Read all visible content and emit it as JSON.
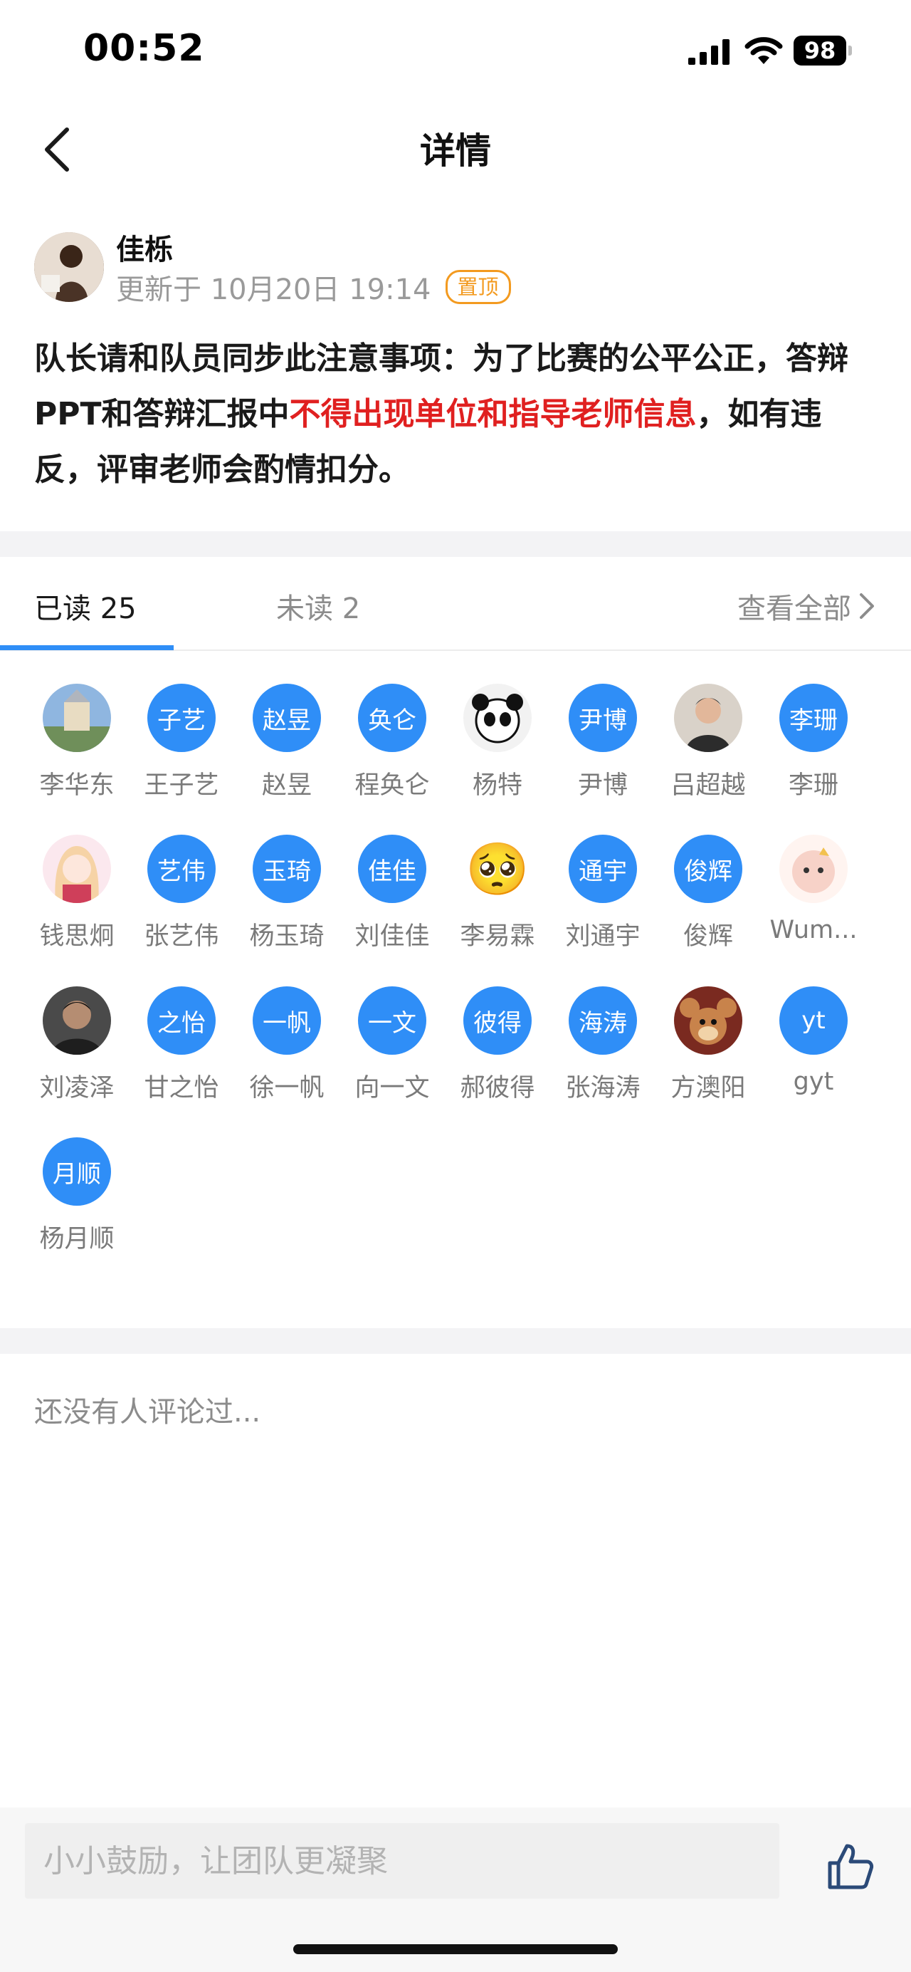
{
  "status_bar": {
    "time": "00:52",
    "battery": "98"
  },
  "nav": {
    "title": "详情"
  },
  "post": {
    "author": "佳栎",
    "updated": "更新于 10月20日 19:14",
    "pin_badge": "置顶",
    "body_part1": "队长请和队员同步此注意事项：为了比赛的公平公正，答辩PPT和答辩汇报中",
    "body_highlight": "不得出现单位和指导老师信息",
    "body_part2": "，如有违反，评审老师会酌情扣分。"
  },
  "tabs": {
    "read": "已读 25",
    "unread": "未读 2",
    "view_all": "查看全部"
  },
  "members": [
    {
      "name": "李华东",
      "avatar_text": "",
      "avatar_kind": "photo-castle"
    },
    {
      "name": "王子艺",
      "avatar_text": "子艺"
    },
    {
      "name": "赵昱",
      "avatar_text": "赵昱"
    },
    {
      "name": "程奂仑",
      "avatar_text": "奂仑"
    },
    {
      "name": "杨特",
      "avatar_text": "",
      "avatar_kind": "photo-panda"
    },
    {
      "name": "尹博",
      "avatar_text": "尹博"
    },
    {
      "name": "吕超越",
      "avatar_text": "",
      "avatar_kind": "photo-man"
    },
    {
      "name": "李珊",
      "avatar_text": "李珊"
    },
    {
      "name": "钱思炯",
      "avatar_text": "",
      "avatar_kind": "photo-anime"
    },
    {
      "name": "张艺伟",
      "avatar_text": "艺伟"
    },
    {
      "name": "杨玉琦",
      "avatar_text": "玉琦"
    },
    {
      "name": "刘佳佳",
      "avatar_text": "佳佳"
    },
    {
      "name": "李易霖",
      "avatar_text": "🥺",
      "avatar_kind": "emoji"
    },
    {
      "name": "刘通宇",
      "avatar_text": "通宇"
    },
    {
      "name": "俊辉",
      "avatar_text": "俊辉"
    },
    {
      "name": "Wum...",
      "avatar_text": "",
      "avatar_kind": "photo-cartoon"
    },
    {
      "name": "刘凌泽",
      "avatar_text": "",
      "avatar_kind": "photo-portrait"
    },
    {
      "name": "甘之怡",
      "avatar_text": "之怡"
    },
    {
      "name": "徐一帆",
      "avatar_text": "一帆"
    },
    {
      "name": "向一文",
      "avatar_text": "一文"
    },
    {
      "name": "郝彼得",
      "avatar_text": "彼得"
    },
    {
      "name": "张海涛",
      "avatar_text": "海涛"
    },
    {
      "name": "方澳阳",
      "avatar_text": "",
      "avatar_kind": "photo-jerry"
    },
    {
      "name": "gyt",
      "avatar_text": "yt"
    },
    {
      "name": "杨月顺",
      "avatar_text": "月顺"
    }
  ],
  "comments": {
    "empty_text": "还没有人评论过..."
  },
  "bottom": {
    "input_placeholder": "小小鼓励，让团队更凝聚"
  },
  "colors": {
    "accent": "#2f8ef7",
    "highlight": "#e02020",
    "pin": "#f39a1f"
  }
}
